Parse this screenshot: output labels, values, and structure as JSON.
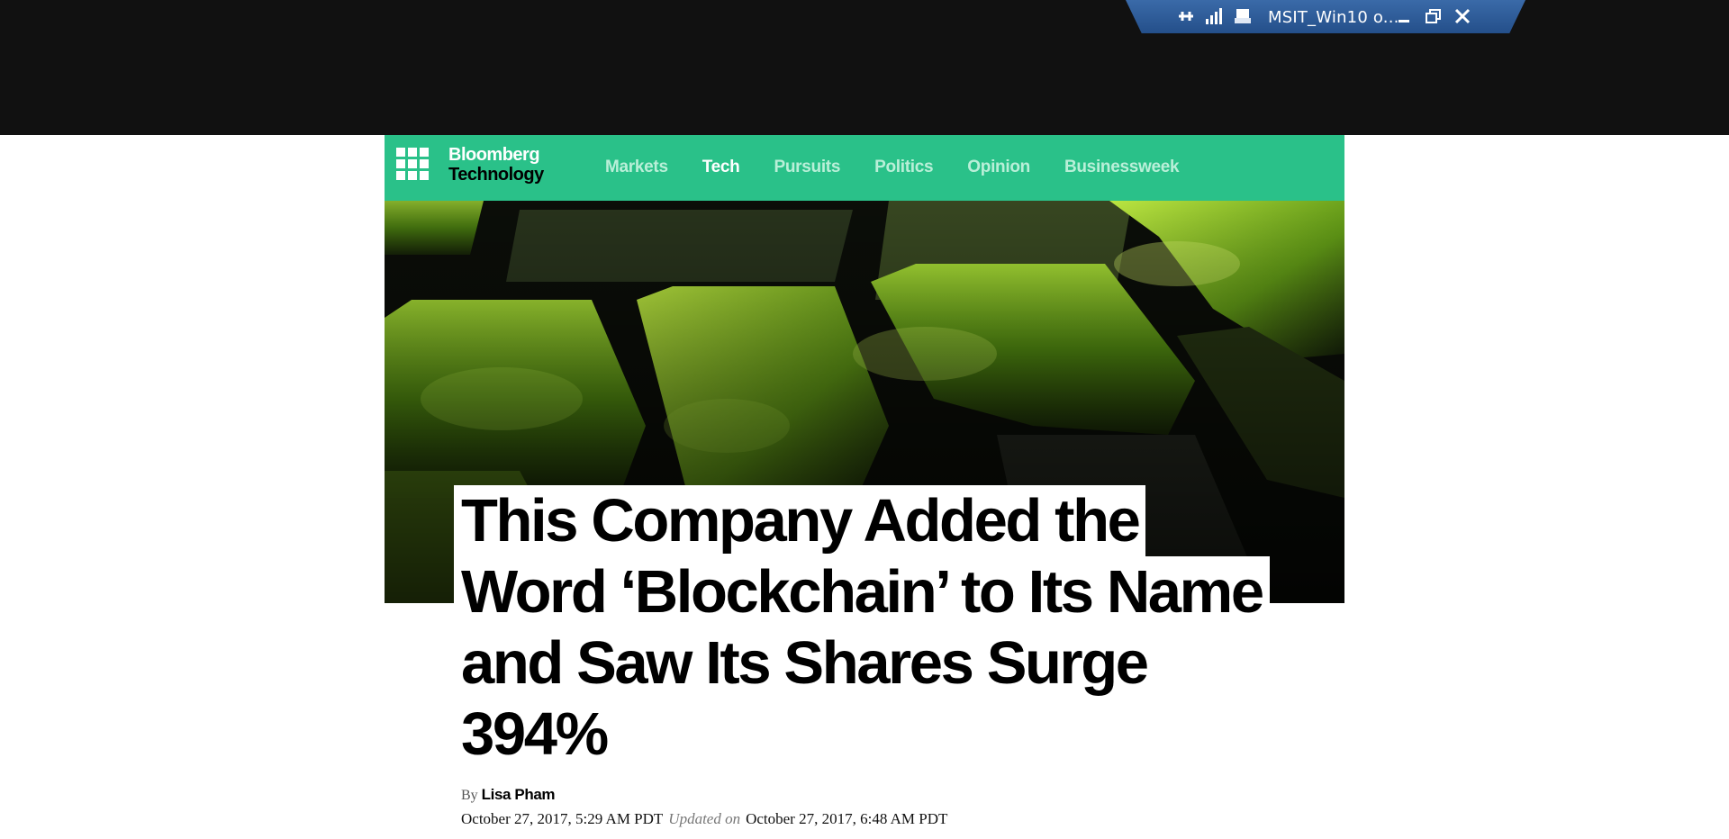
{
  "remote_bar": {
    "title": "MSIT_Win10 o...",
    "icons": [
      "pin-icon",
      "signal-icon",
      "device-icon",
      "minimize-icon",
      "restore-icon",
      "close-icon"
    ]
  },
  "nav": {
    "brand_line1": "Bloomberg",
    "brand_line2": "Technology",
    "items": [
      {
        "label": "Markets",
        "active": false
      },
      {
        "label": "Tech",
        "active": true
      },
      {
        "label": "Pursuits",
        "active": false
      },
      {
        "label": "Politics",
        "active": false
      },
      {
        "label": "Opinion",
        "active": false
      },
      {
        "label": "Businessweek",
        "active": false
      }
    ],
    "accent_color": "#2ac189"
  },
  "article": {
    "headline_lines": [
      "This Company Added the",
      "Word ‘Blockchain’ to Its Name",
      "and Saw Its Shares Surge",
      "394%"
    ],
    "by_label": "By",
    "author": "Lisa Pham",
    "published": "October 27, 2017, 5:29 AM PDT",
    "updated_label": "Updated on",
    "updated": "October 27, 2017, 6:48 AM PDT"
  }
}
